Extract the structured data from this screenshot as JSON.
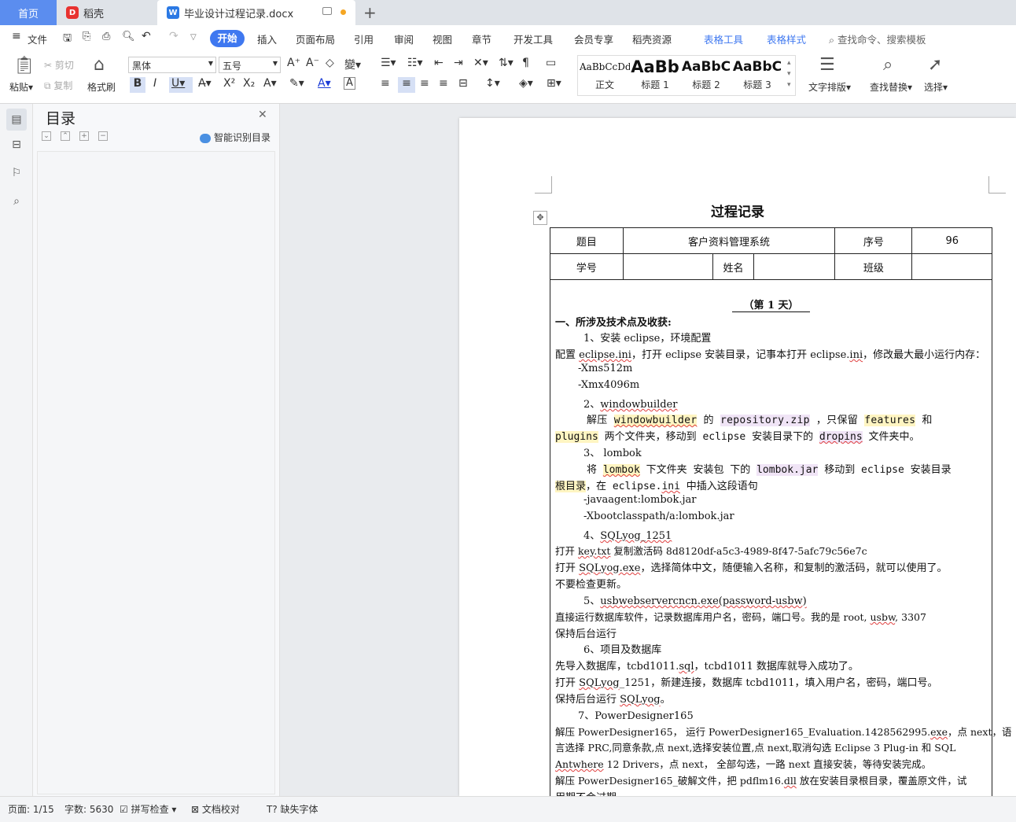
{
  "tabs": {
    "home": "首页",
    "daoke": "稻壳",
    "doc": "毕业设计过程记录.docx",
    "plus": "+"
  },
  "menu": {
    "file": "文件",
    "items": [
      "开始",
      "插入",
      "页面布局",
      "引用",
      "审阅",
      "视图",
      "章节",
      "开发工具",
      "会员专享",
      "稻壳资源"
    ],
    "table_tools": "表格工具",
    "table_style": "表格样式",
    "search": "查找命令、搜索模板"
  },
  "ribbon": {
    "paste": "粘贴",
    "cut": "剪切",
    "copy": "复制",
    "format_painter": "格式刷",
    "font_name": "黑体",
    "font_size": "五号",
    "styles": [
      {
        "preview": "AaBbCcDd",
        "name": "正文"
      },
      {
        "preview": "AaBb",
        "name": "标题 1"
      },
      {
        "preview": "AaBbC",
        "name": "标题 2"
      },
      {
        "preview": "AaBbC",
        "name": "标题 3"
      }
    ],
    "text_layout": "文字排版",
    "find_replace": "查找替换",
    "select": "选择"
  },
  "toc": {
    "title": "目录",
    "ai_label": "智能识别目录"
  },
  "document": {
    "title": "过程记录",
    "header_row1": [
      "题目",
      "客户资料管理系统",
      "序号",
      "96"
    ],
    "header_row2": [
      "学号",
      "",
      "姓名",
      "",
      "班级",
      ""
    ],
    "day_heading": "（第 1 天）",
    "section1": "一、所涉及技术点及收获:",
    "lines": {
      "l1": "1、安装 eclipse，环境配置",
      "l2a": "配置 ",
      "l2b": "eclipse.ini",
      "l2c": "，打开 eclipse 安装目录，记事本打开 eclipse.",
      "l2d": "ini",
      "l2e": "，修改最大最小运行内存：",
      "l3": "-Xms512m",
      "l4": "-Xmx4096m",
      "l5a": "2、",
      "l5b": "windowbuilder",
      "l6a": "解压 ",
      "l6b": "windowbuilder",
      "l6c": " 的 ",
      "l6d": "repository.zip",
      "l6e": " ，只保留 ",
      "l6f": "features",
      "l6g": " 和",
      "l7a": "plugins",
      "l7b": " 两个文件夹，移动到 eclipse 安装目录下的 ",
      "l7c": "dropins",
      "l7d": " 文件夹中。",
      "l8a": "3、  ",
      "l8b": "lombok",
      "l9a": "将 ",
      "l9b": "lombok",
      "l9c": " 下文件夹 安装包 下的 ",
      "l9d": "lombok.jar",
      "l9e": " 移动到 eclipse 安装目录",
      "l10a": "根目录",
      "l10b": "，在 eclipse.",
      "l10c": "ini",
      "l10d": " 中插入这段语句",
      "l11": "-javaagent:lombok.jar",
      "l12": "-Xbootclasspath/a:lombok.jar",
      "l13a": "4、",
      "l13b": "SQLyog_1251",
      "l14a": "打开 ",
      "l14b": "key.txt",
      "l14c": " 复制激活码 8d8120df-a5c3-4989-8f47-5afc79c56e7c",
      "l15a": "打开 ",
      "l15b": "SQLyog.exe",
      "l15c": "，选择简体中文，随便输入名称，和复制的激活码，就可以使用了。",
      "l16": "不要检查更新。",
      "l17a": "5、",
      "l17b": "usbwebservercncn.exe(password-usbw)",
      "l18a": "直接运行数据库软件，记录数据库用户名，密码，端口号。我的是 root, ",
      "l18b": "usbw",
      "l18c": ", 3307",
      "l19": "保持后台运行",
      "l20": "6、项目及数据库",
      "l21a": "先导入数据库，tcbd1011.",
      "l21b": "sql",
      "l21c": "，tcbd1011 数据库就导入成功了。",
      "l22a": "打开 ",
      "l22b": "SQLyog",
      "l22c": "_1251，新建连接，数据库 tcbd1011，填入用户名，密码，端口号。",
      "l23a": "保持后台运行 ",
      "l23b": "SQLyog",
      "l23c": "。",
      "l24": "7、PowerDesigner165",
      "l25a": "解压 PowerDesigner165， 运行 PowerDesigner165_Evaluation.1428562995.",
      "l25b": "exe",
      "l25c": "，点 next，语",
      "l26": "言选择 PRC,同意条款,点 next,选择安装位置,点 next,取消勾选 Eclipse 3 Plug-in 和 SQL",
      "l27a": "Antwhere",
      "l27b": " 12 Drivers，点 next， 全部勾选，一路 next 直接安装，等待安装完成。",
      "l28a": "解压 PowerDesigner165_破解文件，把 pdflm16.",
      "l28b": "dll",
      "l28c": " 放在安装目录根目录，覆盖原文件，试",
      "l29": "用期不会过期。"
    }
  },
  "status": {
    "page": "页面: 1/15",
    "words": "字数: 5630",
    "spell": "拼写检查",
    "proof": "文档校对",
    "missing_font": "缺失字体"
  },
  "colors": {
    "accent": "#3f78f0",
    "home_tab": "#5b8def"
  }
}
